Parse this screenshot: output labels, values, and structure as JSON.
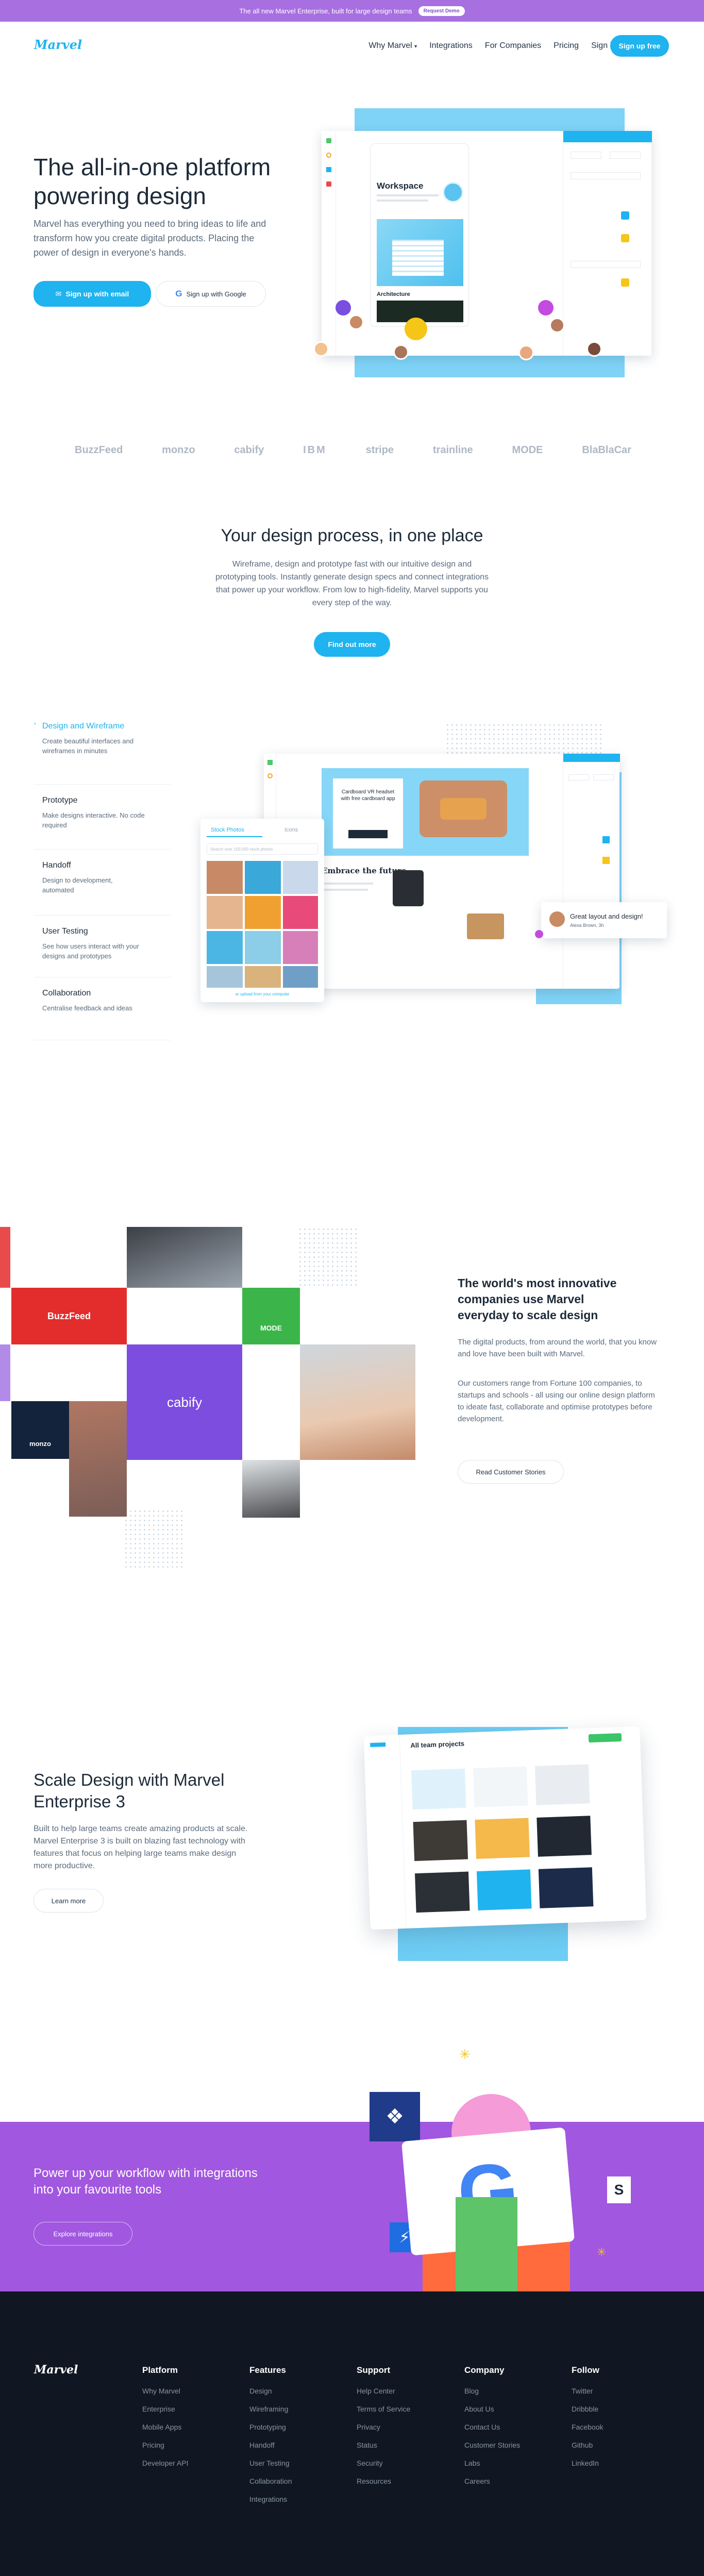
{
  "banner": {
    "text": "The all new Marvel Enterprise, built for large design teams",
    "cta": "Request Demo"
  },
  "nav": {
    "logo": "Marvel",
    "links": [
      "Why Marvel",
      "Integrations",
      "For Companies",
      "Pricing",
      "Sign in"
    ],
    "signup": "Sign up free"
  },
  "hero": {
    "title": "The all-in-one platform powering design",
    "subtitle": "Marvel has everything you need to bring ideas to life and transform how you create digital products. Placing the power of design in everyone's hands.",
    "btn_email": "Sign up with email",
    "btn_google": "Sign up with Google",
    "mock": {
      "app_title": "Workspace",
      "app_label": "Architecture"
    }
  },
  "logos": [
    "BuzzFeed",
    "monzo",
    "cabify",
    "IBM",
    "stripe",
    "trainline",
    "MODE",
    "BlaBlaCar"
  ],
  "process": {
    "title": "Your design process, in one place",
    "text": "Wireframe, design and prototype fast with our intuitive design and prototyping tools. Instantly generate design specs and connect integrations that power up your workflow. From low to high-fidelity, Marvel supports you every step of the way.",
    "cta": "Find out more"
  },
  "features": [
    {
      "title": "Design and Wireframe",
      "desc": "Create beautiful interfaces and wireframes in minutes"
    },
    {
      "title": "Prototype",
      "desc": "Make designs interactive. No code required"
    },
    {
      "title": "Handoff",
      "desc": "Design to development, automated"
    },
    {
      "title": "User Testing",
      "desc": "See how users interact with your designs and prototypes"
    },
    {
      "title": "Collaboration",
      "desc": "Centralise feedback and ideas"
    }
  ],
  "feature_mock": {
    "tabs": [
      "Stock Photos",
      "Icons"
    ],
    "search": "Search over 100,000 stock photos",
    "bottom_link": "or upload from your computer",
    "comment": "Great layout and design!",
    "comment_by": "Alexa Brown, 3h",
    "banner_title": "Cardboard VR headset with free cardboard app",
    "section_title": "Embrace the future"
  },
  "companies": {
    "title": "The world's most innovative companies use Marvel everyday to scale design",
    "p1": "The digital products, from around the world, that you know and love have been built with Marvel.",
    "p2": "Our customers range from Fortune 100 companies, to startups and schools - all using our online design platform to ideate fast, collaborate and optimise prototypes before development.",
    "cta": "Read Customer Stories",
    "tiles": {
      "buzzfeed": "BuzzFeed",
      "mode": "MODE",
      "cabify": "cabify",
      "monzo": "monzo"
    }
  },
  "enterprise": {
    "title": "Scale Design with Marvel Enterprise 3",
    "text": "Built to help large teams create amazing products at scale. Marvel Enterprise 3 is built on blazing fast technology with features that focus on helping large teams make design more productive.",
    "cta": "Learn more",
    "mock_title": "All team projects"
  },
  "integrations": {
    "title": "Power up your workflow with integrations into your favourite tools",
    "cta": "Explore integrations"
  },
  "footer": {
    "logo": "Marvel",
    "columns": [
      {
        "title": "Platform",
        "links": [
          "Why Marvel",
          "Enterprise",
          "Mobile Apps",
          "Pricing",
          "Developer API"
        ]
      },
      {
        "title": "Features",
        "links": [
          "Design",
          "Wireframing",
          "Prototyping",
          "Handoff",
          "User Testing",
          "Collaboration",
          "Integrations"
        ]
      },
      {
        "title": "Support",
        "links": [
          "Help Center",
          "Terms of Service",
          "Privacy",
          "Status",
          "Security",
          "Resources"
        ]
      },
      {
        "title": "Company",
        "links": [
          "Blog",
          "About Us",
          "Contact Us",
          "Customer Stories",
          "Labs",
          "Careers"
        ]
      },
      {
        "title": "Follow",
        "links": [
          "Twitter",
          "Dribbble",
          "Facebook",
          "Github",
          "LinkedIn"
        ]
      }
    ]
  }
}
